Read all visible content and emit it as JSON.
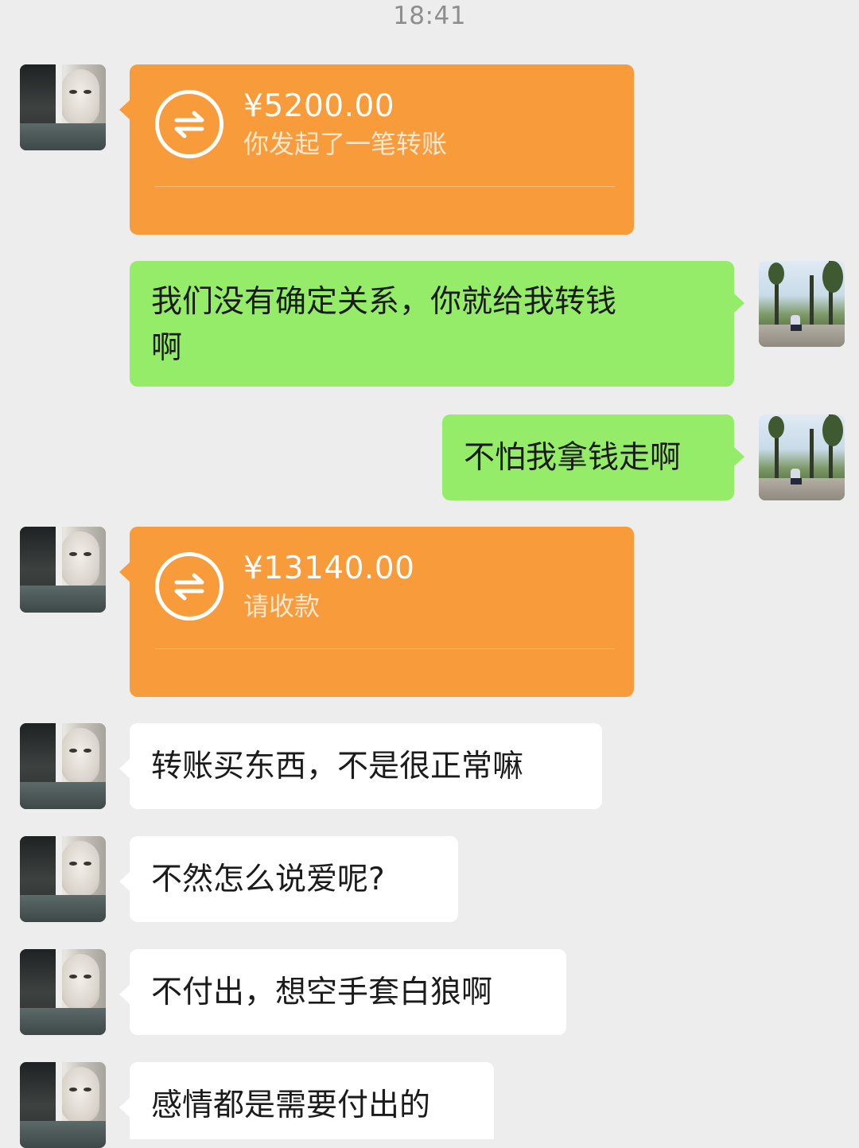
{
  "status_time": "18:41",
  "messages": [
    {
      "sender": "other",
      "type": "transfer",
      "amount": "¥5200.00",
      "note": "你发起了一笔转账"
    },
    {
      "sender": "me",
      "type": "text",
      "lines": [
        "我们没有确定关系，你就给我转钱",
        "啊"
      ]
    },
    {
      "sender": "me",
      "type": "text",
      "lines": [
        "不怕我拿钱走啊"
      ]
    },
    {
      "sender": "other",
      "type": "transfer",
      "amount": "¥13140.00",
      "note": "请收款"
    },
    {
      "sender": "other",
      "type": "text",
      "lines": [
        "转账买东西，不是很正常嘛"
      ]
    },
    {
      "sender": "other",
      "type": "text",
      "lines": [
        "不然怎么说爱呢?"
      ]
    },
    {
      "sender": "other",
      "type": "text",
      "lines": [
        "不付出，想空手套白狼啊"
      ]
    },
    {
      "sender": "other",
      "type": "text",
      "lines": [
        "感情都是需要付出的"
      ]
    }
  ],
  "colors": {
    "background": "#ededed",
    "transfer_bubble": "#f79b3b",
    "my_bubble": "#95ec69",
    "their_bubble": "#ffffff"
  },
  "icons": {
    "transfer": "transfer-arrows-icon"
  }
}
